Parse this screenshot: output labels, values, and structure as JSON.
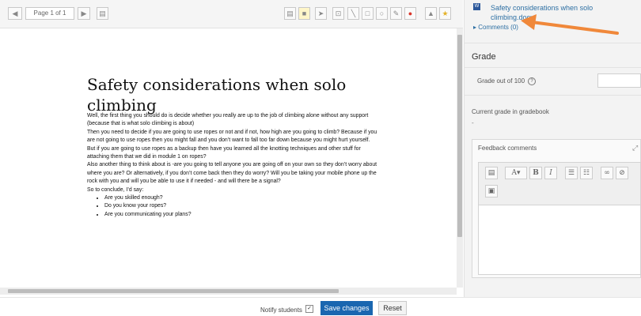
{
  "toolbar": {
    "page_indicator": "Page 1 of 1",
    "prev_icon": "triangle-left",
    "next_icon": "triangle-right",
    "tools": [
      "comment-icon",
      "highlight-icon",
      "select-pointer-icon",
      "stamp-icon",
      "line-icon",
      "rectangle-icon",
      "oval-icon",
      "pen-icon",
      "color-drop-icon",
      "searchlight-icon",
      "star-icon"
    ]
  },
  "document": {
    "title": "Safety considerations when solo climbing",
    "paragraphs": [
      "Well, the first thing you should do is decide whether you really are up to the job of climbing alone without any support (because that is what solo climbing is about)",
      "Then you need to decide if you are going to use ropes or not and if not, how high are you going to climb? Because if you are not going to use ropes then you might fall and you don’t want to fall too far down because you might hurt yourself.",
      "But if you are going to use ropes as a backup then have you learned all the knotting techniques and other stuff for attaching them that we did in module 1 on ropes?",
      "Also another thing to think about is -are you going to tell anyone you are going off on your own so they don’t worry about where you are? Or alternatively, if you don’t come back then they do worry? Will you be taking your mobile phone up the rock with you and will you be able to use it if needed - and will there be a signal?",
      "So to conclude, I’d say:"
    ],
    "bullets": [
      "Are you skilled enough?",
      "Do you know your ropes?",
      "Are you communicating your plans?"
    ]
  },
  "submission": {
    "file_name": "Safety considerations when solo climbing.docx",
    "comments_link": "Comments (0)"
  },
  "grade": {
    "heading": "Grade",
    "grade_out_label": "Grade out of 100",
    "grade_value": "",
    "current_label": "Current grade in gradebook",
    "current_value": "-"
  },
  "feedback": {
    "label": "Feedback comments"
  },
  "footer": {
    "notify_label": "Notify students",
    "save_label": "Save changes",
    "reset_label": "Reset"
  },
  "colors": {
    "accent": "#1a66b0",
    "arrow": "#f0883a",
    "link": "#2d6fa3"
  }
}
